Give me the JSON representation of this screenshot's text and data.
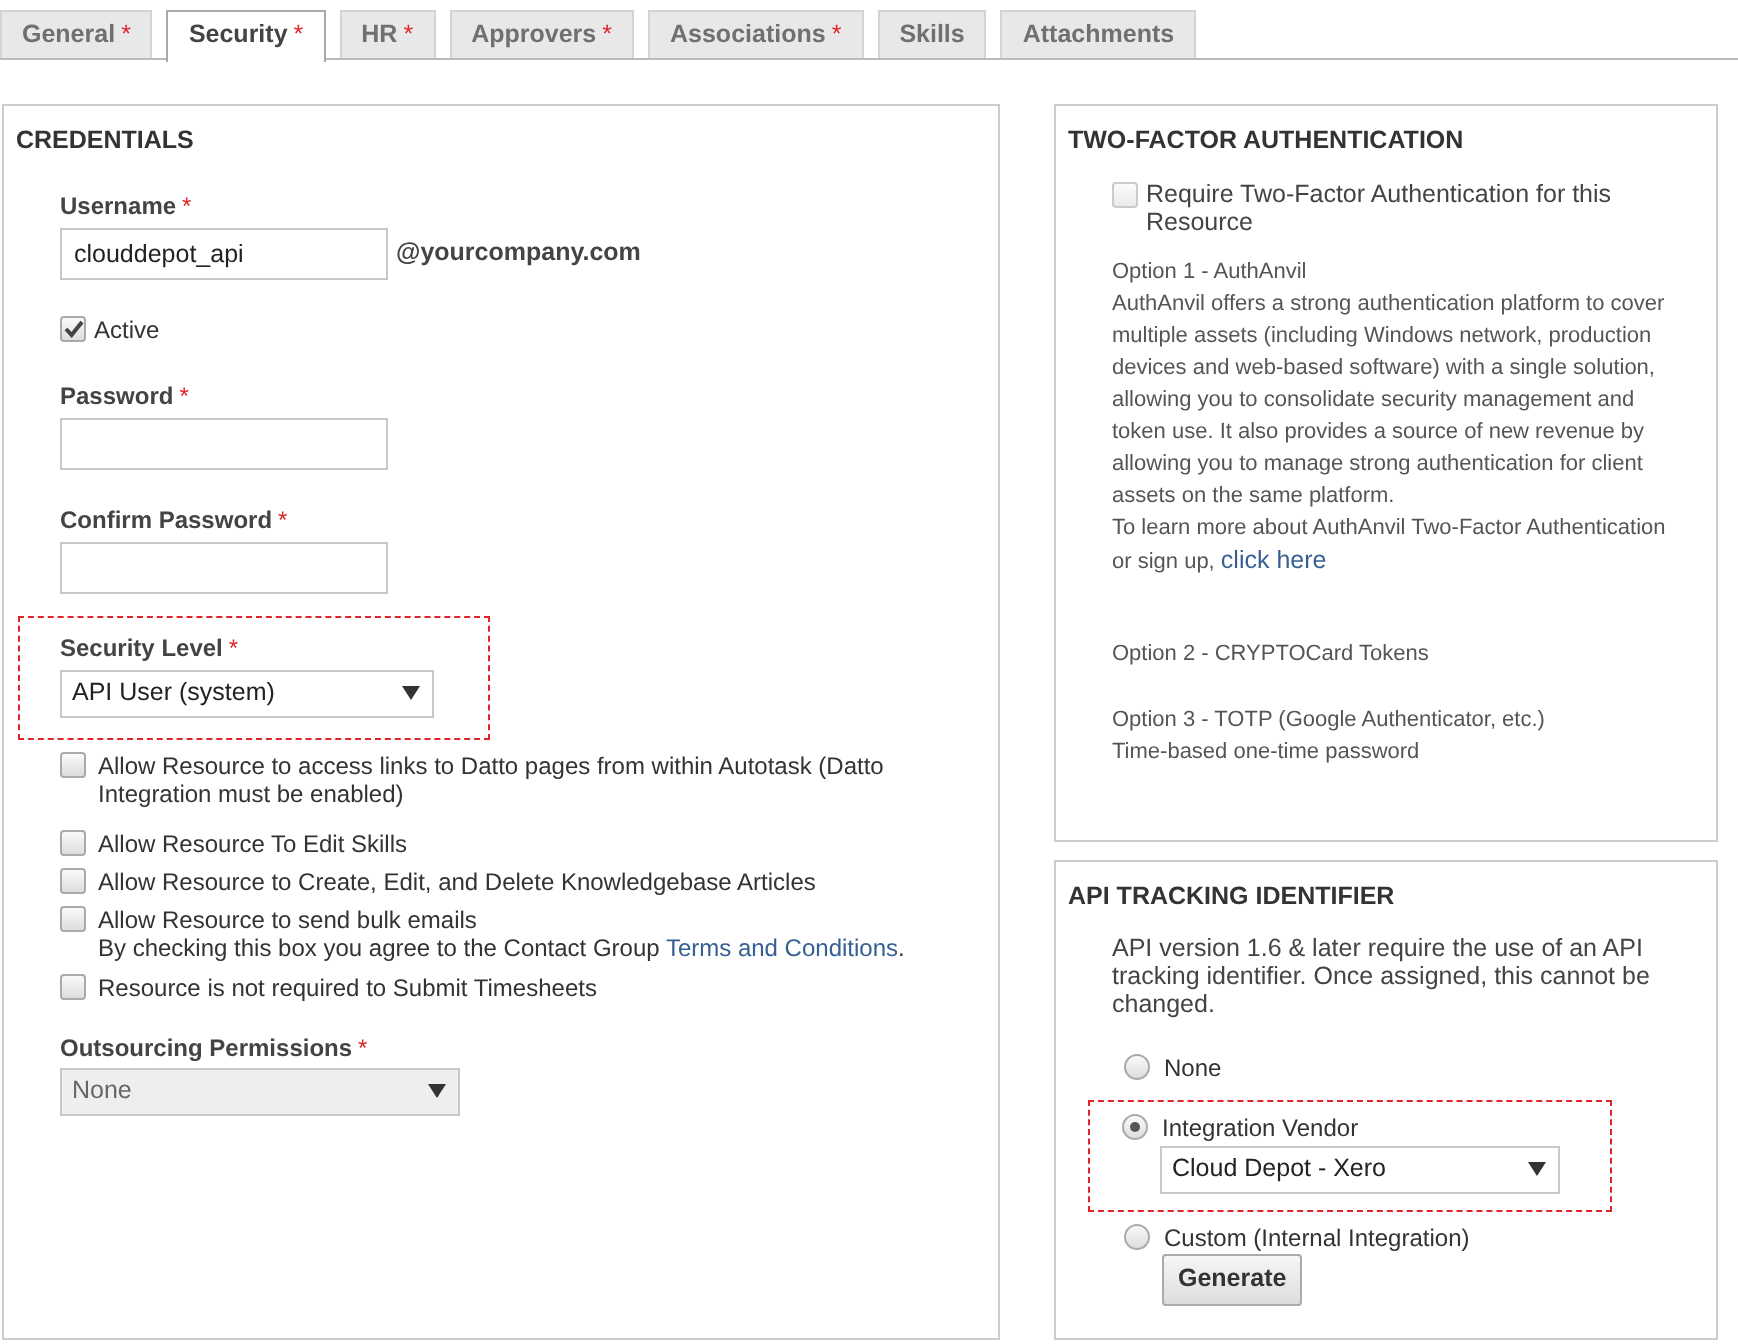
{
  "tabs": [
    {
      "label": "General",
      "required": "*",
      "selected": false
    },
    {
      "label": "Security",
      "required": "*",
      "selected": true
    },
    {
      "label": "HR",
      "required": "*",
      "selected": false
    },
    {
      "label": "Approvers",
      "required": "*",
      "selected": false
    },
    {
      "label": "Associations",
      "required": "*",
      "selected": false
    },
    {
      "label": "Skills",
      "selected": false
    },
    {
      "label": "Attachments",
      "selected": false
    }
  ],
  "credentials": {
    "title": "CREDENTIALS",
    "username": {
      "label": "Username",
      "required": "*",
      "value": "clouddepot_api",
      "suffix": "@yourcompany.com"
    },
    "active": {
      "label": "Active",
      "checked": true
    },
    "password": {
      "label": "Password",
      "required": "*"
    },
    "confirm_password": {
      "label": "Confirm Password",
      "required": "*"
    },
    "security_level": {
      "label": "Security Level",
      "required": "*",
      "value": "API User (system)",
      "highlighted": true
    },
    "permissions": [
      {
        "label": "Allow Resource to access links to Datto pages from within Autotask (Datto Integration must be enabled)",
        "checked": false
      },
      {
        "label": "Allow Resource To Edit Skills",
        "checked": false
      },
      {
        "label": "Allow Resource to Create, Edit, and Delete Knowledgebase Articles",
        "checked": false
      },
      {
        "label": "Allow Resource to send bulk emails",
        "checked": false,
        "note": "By checking this box you agree to the Contact Group ",
        "note_link": "Terms and Conditions",
        "note_end": "."
      },
      {
        "label": "Resource is not required to Submit Timesheets",
        "checked": false
      }
    ],
    "outsourcing": {
      "label": "Outsourcing Permissions",
      "required": "*",
      "value": "None",
      "disabled": true
    }
  },
  "two_factor": {
    "title": "TWO-FACTOR AUTHENTICATION",
    "require": {
      "label": "Require Two-Factor Authentication for this Resource",
      "checked": false,
      "disabled": true
    },
    "options": [
      {
        "heading": "Option 1 - AuthAnvil",
        "text": "AuthAnvil offers a strong authentication platform to cover multiple assets (including Windows network, production devices and web-based software) with a single solution, allowing you to consolidate security management and token use. It also provides a source of new revenue by allowing you to manage strong authentication for client assets on the same platform.",
        "more": "To learn more about AuthAnvil Two-Factor Authentication or sign up, ",
        "link": "click here"
      },
      {
        "heading": "Option 2 - CRYPTOCard Tokens"
      },
      {
        "heading": "Option 3 - TOTP (Google Authenticator, etc.)",
        "text": "Time-based one-time password"
      }
    ]
  },
  "api_tracking": {
    "title": "API TRACKING IDENTIFIER",
    "description": "API version 1.6 & later require the use of an API tracking identifier. Once assigned, this cannot be changed.",
    "choices": [
      {
        "label": "None",
        "selected": false
      },
      {
        "label": "Integration Vendor",
        "selected": true,
        "highlighted": true,
        "value": "Cloud Depot - Xero"
      },
      {
        "label": "Custom (Internal Integration)",
        "selected": false,
        "button": "Generate"
      }
    ]
  }
}
